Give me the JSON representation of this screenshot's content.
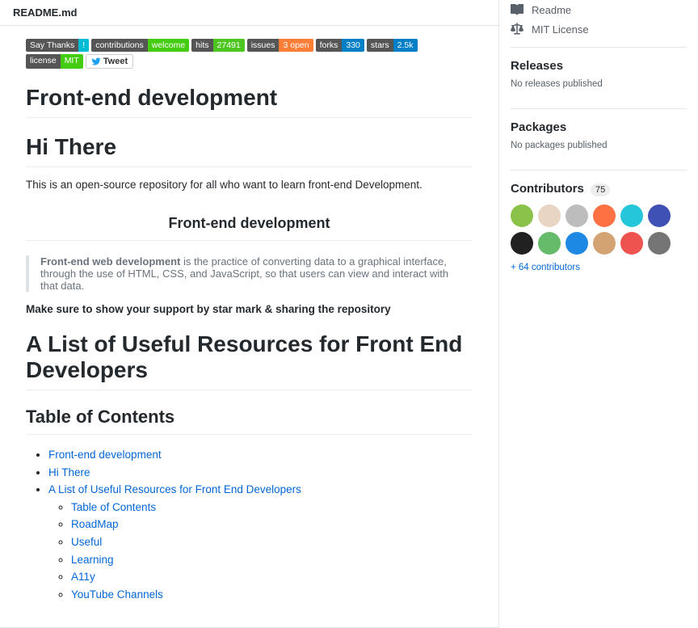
{
  "readme": {
    "filename": "README.md",
    "badges": [
      {
        "left": "Say Thanks",
        "right": "!",
        "rightClass": "br-cyan"
      },
      {
        "left": "contributions",
        "right": "welcome",
        "rightClass": "br-green"
      },
      {
        "left": "hits",
        "right": "27491",
        "rightClass": "br-teal"
      },
      {
        "left": "issues",
        "right": "3 open",
        "rightClass": "br-orange"
      },
      {
        "left": "forks",
        "right": "330",
        "rightClass": "br-blue"
      },
      {
        "left": "stars",
        "right": "2.5k",
        "rightClass": "br-blue"
      },
      {
        "left": "license",
        "right": "MIT",
        "rightClass": "br-green"
      }
    ],
    "tweet_label": "Tweet",
    "h1_a": "Front-end development",
    "h1_b": "Hi There",
    "intro": "This is an open-source repository for all who want to learn front-end Development.",
    "centered_heading": "Front-end development",
    "quote_strong": "Front-end web development",
    "quote_rest": " is the practice of converting data to a graphical interface, through the use of HTML, CSS, and JavaScript, so that users can view and interact with that data.",
    "support": "Make sure to show your support by star mark & sharing the repository",
    "h1_c": "A List of Useful Resources for Front End Developers",
    "toc_heading": "Table of Contents",
    "toc": {
      "items": [
        "Front-end development",
        "Hi There",
        "A List of Useful Resources for Front End Developers"
      ],
      "subitems": [
        "Table of Contents",
        "RoadMap",
        "Useful",
        "Learning",
        "A11y",
        "YouTube Channels"
      ]
    }
  },
  "sidebar": {
    "readme_link": "Readme",
    "license_link": "MIT License",
    "releases": {
      "title": "Releases",
      "text": "No releases published"
    },
    "packages": {
      "title": "Packages",
      "text": "No packages published"
    },
    "contributors": {
      "title": "Contributors",
      "count": "75",
      "avatars": [
        "#8bc34a",
        "#e8d5c4",
        "#bdbdbd",
        "#ff7043",
        "#26c6da",
        "#3f51b5",
        "#212121",
        "#66bb6a",
        "#1e88e5",
        "#d4a373",
        "#ef5350",
        "#757575"
      ],
      "more": "+ 64 contributors"
    }
  }
}
